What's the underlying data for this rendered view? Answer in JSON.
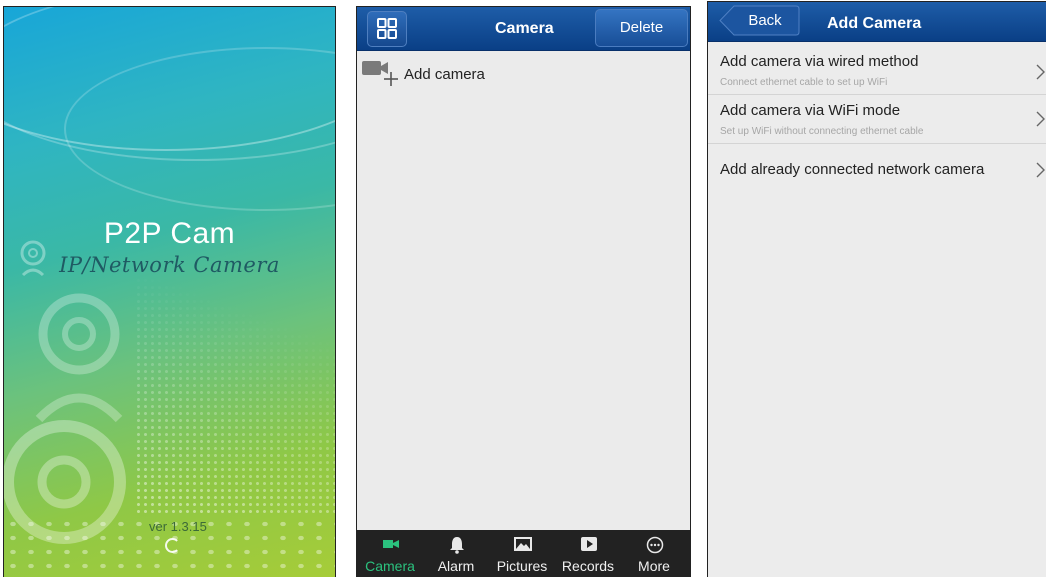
{
  "splash": {
    "app_name": "P2P Cam",
    "subtitle": "IP/Network Camera",
    "version": "ver 1.3.15"
  },
  "camera_list": {
    "title": "Camera",
    "delete_label": "Delete",
    "grid_icon": "grid-icon",
    "add_camera_label": "Add camera",
    "add_camera_icon": "video-camera-plus-icon",
    "tabs": [
      {
        "label": "Camera",
        "icon": "video-camera-icon",
        "active": true
      },
      {
        "label": "Alarm",
        "icon": "bell-icon",
        "active": false
      },
      {
        "label": "Pictures",
        "icon": "picture-icon",
        "active": false
      },
      {
        "label": "Records",
        "icon": "play-icon",
        "active": false
      },
      {
        "label": "More",
        "icon": "more-icon",
        "active": false
      }
    ]
  },
  "add_camera": {
    "back_label": "Back",
    "title": "Add Camera",
    "options": [
      {
        "title": "Add camera via wired method",
        "subtitle": "Connect ethernet cable to set up WiFi"
      },
      {
        "title": "Add camera via WiFi mode",
        "subtitle": "Set up WiFi without connecting ethernet cable"
      },
      {
        "title": "Add already connected network camera",
        "subtitle": ""
      }
    ]
  },
  "colors": {
    "navbar_blue": "#0a3f86",
    "tab_active": "#2bc17e",
    "tabbar_bg": "#222222"
  }
}
